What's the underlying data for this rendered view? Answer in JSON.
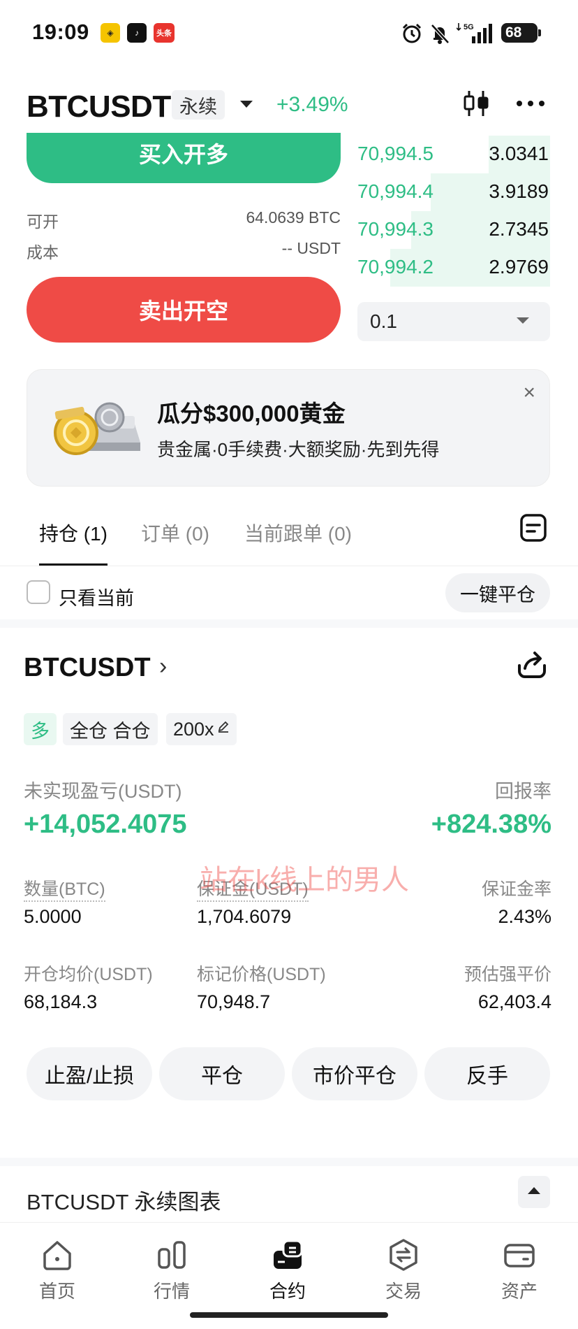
{
  "status_bar": {
    "time": "19:09",
    "app_toutiao": "头条",
    "signal": "5G",
    "battery": "68",
    "icons": [
      "alarm-icon",
      "mute-icon",
      "signal-icon",
      "battery-icon"
    ]
  },
  "header": {
    "pair": "BTCUSDT",
    "contract_type": "永续",
    "change": "+3.49%",
    "icons": [
      "chevron-down-icon",
      "candlestick-icon",
      "more-icon"
    ]
  },
  "trade": {
    "buy_label": "买入开多",
    "available_label": "可开",
    "available_value": "64.0639 BTC",
    "cost_label": "成本",
    "cost_value": "-- USDT",
    "sell_label": "卖出开空",
    "orderbook": [
      {
        "price": "70,994.5",
        "qty": "3.0341",
        "depth": 0.32
      },
      {
        "price": "70,994.4",
        "qty": "3.9189",
        "depth": 0.62
      },
      {
        "price": "70,994.3",
        "qty": "2.7345",
        "depth": 0.72
      },
      {
        "price": "70,994.2",
        "qty": "2.9769",
        "depth": 0.83
      }
    ],
    "precision_value": "0.1"
  },
  "promo": {
    "title": "瓜分$300,000黄金",
    "subtitle": "贵金属·0手续费·大额奖励·先到先得",
    "close": "×"
  },
  "tabs": [
    {
      "label": "持仓 (1)",
      "active": true
    },
    {
      "label": "订单 (0)",
      "active": false
    },
    {
      "label": "当前跟单 (0)",
      "active": false
    }
  ],
  "filter": {
    "only_current": "只看当前",
    "close_all": "一键平仓"
  },
  "position": {
    "pair": "BTCUSDT",
    "chevron": "›",
    "side": "多",
    "margin_mode": "全仓 合仓",
    "leverage": "200x",
    "pnl_label": "未实现盈亏(USDT)",
    "pnl_value": "+14,052.4075",
    "roe_label": "回报率",
    "roe_value": "+824.38%",
    "stats_row1": [
      {
        "label": "数量(BTC)",
        "value": "5.0000"
      },
      {
        "label": "保证金(USDT)",
        "value": "1,704.6079"
      },
      {
        "label": "保证金率",
        "value": "2.43%"
      }
    ],
    "stats_row2": [
      {
        "label": "开仓均价(USDT)",
        "value": "68,184.3"
      },
      {
        "label": "标记价格(USDT)",
        "value": "70,948.7"
      },
      {
        "label": "预估强平价",
        "value": "62,403.4"
      }
    ],
    "actions": [
      "止盈/止损",
      "平仓",
      "市价平仓",
      "反手"
    ]
  },
  "watermark": "站在k线上的男人",
  "chart_section": {
    "title": "BTCUSDT 永续图表"
  },
  "nav": [
    {
      "label": "首页",
      "icon": "home-icon"
    },
    {
      "label": "行情",
      "icon": "market-icon"
    },
    {
      "label": "合约",
      "icon": "futures-icon",
      "active": true
    },
    {
      "label": "交易",
      "icon": "trade-icon"
    },
    {
      "label": "资产",
      "icon": "wallet-icon"
    }
  ],
  "colors": {
    "green": "#2ebd85",
    "red": "#ef4b46"
  }
}
